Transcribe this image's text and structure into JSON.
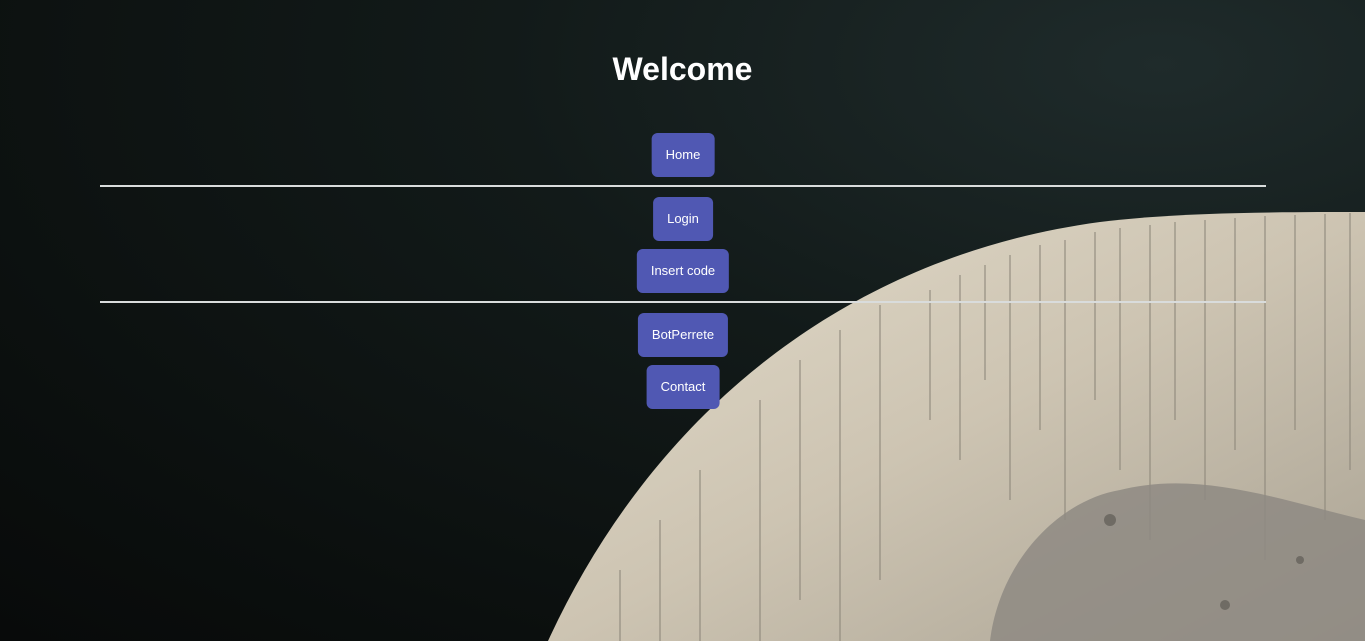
{
  "page": {
    "title": "Welcome"
  },
  "nav": {
    "home": "Home",
    "login": "Login",
    "insert_code": "Insert code",
    "botperrete": "BotPerrete",
    "contact": "Contact"
  },
  "colors": {
    "button": "#5058b3",
    "background": "#0b0f0e",
    "moon": "#cfc6b4",
    "divider": "#d9dcdc"
  }
}
